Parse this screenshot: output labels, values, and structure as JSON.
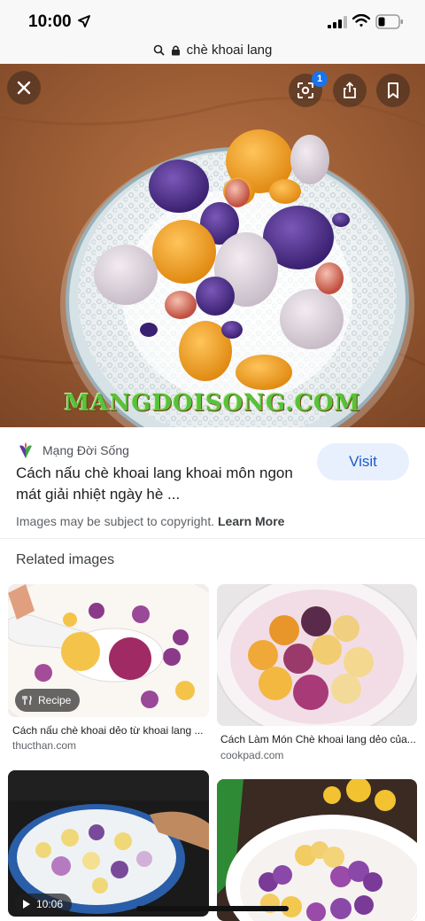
{
  "status": {
    "time": "10:00"
  },
  "url_bar": {
    "query": "chè khoai lang"
  },
  "hero": {
    "watermark": "MANGDOISONG.COM",
    "lens_badge_count": "1"
  },
  "source": {
    "name": "Mạng Đời Sống",
    "title": "Cách nấu chè khoai lang khoai môn ngon mát giải nhiệt ngày hè ...",
    "visit_label": "Visit"
  },
  "copyright": {
    "text": "Images may be subject to copyright.",
    "learn_more": "Learn More"
  },
  "related": {
    "heading": "Related images",
    "items": [
      {
        "title": "Cách nấu chè khoai dẻo từ khoai lang ...",
        "domain": "thucthan.com",
        "badge": "Recipe"
      },
      {
        "title": "Cách Làm Món Chè khoai lang dẻo của...",
        "domain": "cookpad.com",
        "badge": ""
      },
      {
        "title": "",
        "domain": "",
        "badge": "10:06"
      },
      {
        "title": "",
        "domain": "",
        "badge": ""
      }
    ]
  },
  "icons": [
    "navigation-arrow-icon",
    "signal-icon",
    "wifi-icon",
    "battery-icon",
    "search-icon",
    "lock-icon",
    "close-icon",
    "lens-icon",
    "share-icon",
    "bookmark-icon",
    "utensils-icon",
    "play-icon"
  ],
  "colors": {
    "visit_bg": "#e8f0fe",
    "visit_text": "#1a5cc8",
    "watermark": "#58c23b",
    "badge_blue": "#1a73e8"
  }
}
